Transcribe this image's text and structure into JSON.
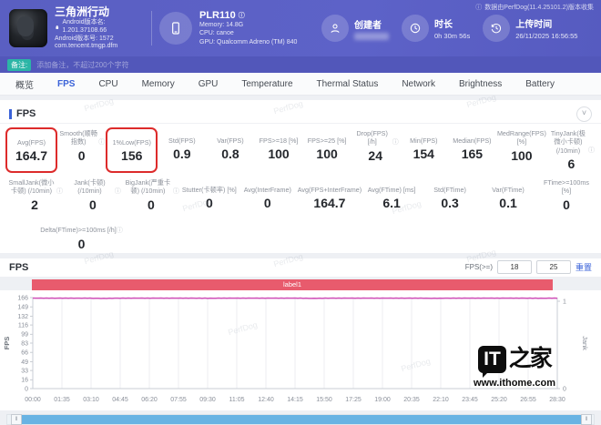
{
  "icons": {
    "info": "ⓘ",
    "chevron_down": "˅"
  },
  "header": {
    "app": {
      "title": "三角洲行动",
      "version_name": "Android版本名: 1.201.37108.66",
      "version_code": "Android版本号: 1572",
      "package": "com.tencent.tmgp.dfm"
    },
    "device": {
      "name": "PLR110",
      "memory": "Memory: 14.8G",
      "cpu": "CPU: canoe",
      "gpu": "GPU: Qualcomm Adreno (TM) 840"
    },
    "creator": {
      "label": "创建者",
      "value": ""
    },
    "duration": {
      "label": "时长",
      "value": "0h 30m 56s"
    },
    "upload": {
      "label": "上传时间",
      "value": "26/11/2025 16:56:55"
    },
    "collector_note": "数据由PerfDog(11.4.25101.2)版本收集"
  },
  "note_bar": {
    "badge": "备注:",
    "text": "添加备注，不超过200个字符"
  },
  "tabs": {
    "items": [
      "概览",
      "FPS",
      "CPU",
      "Memory",
      "GPU",
      "Temperature",
      "Thermal Status",
      "Network",
      "Brightness",
      "Battery"
    ],
    "active": "FPS"
  },
  "fps_card": {
    "title": "FPS",
    "stat_rows": [
      [
        {
          "label": "Avg(FPS)",
          "value": "164.7",
          "highlight": true
        },
        {
          "label": "Smooth(顺畅指数)",
          "info": true,
          "value": "0"
        },
        {
          "label": "1%Low(FPS)",
          "value": "156",
          "highlight": true
        },
        {
          "label": "Std(FPS)",
          "value": "0.9"
        },
        {
          "label": "Var(FPS)",
          "value": "0.8"
        },
        {
          "label": "FPS>=18 [%]",
          "value": "100"
        },
        {
          "label": "FPS>=25 [%]",
          "value": "100"
        },
        {
          "label": "Drop(FPS) [/h]",
          "info": true,
          "value": "24"
        },
        {
          "label": "Min(FPS)",
          "value": "154"
        },
        {
          "label": "Median(FPS)",
          "value": "165"
        },
        {
          "label": "MedRange(FPS)[%]",
          "value": "100"
        },
        {
          "label": "TinyJank(极微小卡顿) (/10min)",
          "info": true,
          "value": "6"
        }
      ],
      [
        {
          "label": "SmallJank(微小卡顿) (/10min)",
          "info": true,
          "value": "2"
        },
        {
          "label": "Jank(卡顿) (/10min)",
          "info": true,
          "value": "0"
        },
        {
          "label": "BigJank(严重卡顿) (/10min)",
          "info": true,
          "value": "0"
        },
        {
          "label": "Stutter(卡顿率) [%]",
          "value": "0"
        },
        {
          "label": "Avg(InterFrame)",
          "value": "0"
        },
        {
          "label": "Avg(FPS+InterFrame)",
          "value": "164.7"
        },
        {
          "label": "Avg(FTime) [ms]",
          "value": "6.1"
        },
        {
          "label": "Std(FTime)",
          "value": "0.3"
        },
        {
          "label": "Var(FTime)",
          "value": "0.1"
        },
        {
          "label": "FTime>=100ms [%]",
          "value": "0"
        }
      ],
      [
        {
          "label": "Delta(FTime)>=100ms [/h]",
          "info": true,
          "value": "0"
        }
      ]
    ]
  },
  "chart": {
    "title": "FPS",
    "threshold_label": "FPS(>=)",
    "threshold_values": [
      "18",
      "25"
    ],
    "reset_label": "重置",
    "banner_label": "label1"
  },
  "chart_data": {
    "type": "line",
    "title": "FPS",
    "ylabel_left": "FPS",
    "ylabel_right": "Jank",
    "ylim_left": [
      0,
      166
    ],
    "ylim_right": [
      0,
      1
    ],
    "y_ticks_left": [
      166,
      149,
      132,
      116,
      99,
      83,
      66,
      49,
      33,
      16,
      0
    ],
    "y_ticks_right": [
      1,
      0
    ],
    "x_ticks": [
      "00:00",
      "01:35",
      "03:10",
      "04:45",
      "06:20",
      "07:55",
      "09:30",
      "11:05",
      "12:40",
      "14:15",
      "15:50",
      "17:25",
      "19:00",
      "20:35",
      "22:10",
      "23:45",
      "25:20",
      "26:55",
      "28:30"
    ],
    "grid": "vertical",
    "legend_banner": "label1",
    "series": [
      {
        "name": "FPS",
        "color": "#cf4fb8",
        "x_minutes": [
          0,
          1,
          2,
          3,
          4,
          5,
          6,
          7,
          8,
          9,
          10,
          11,
          12,
          13,
          14,
          15,
          16,
          17,
          18,
          19,
          20,
          21,
          22,
          23,
          24,
          25,
          26,
          27,
          28,
          29,
          30
        ],
        "values": [
          165,
          165,
          165,
          165,
          164.5,
          165,
          165,
          165,
          165,
          165,
          164.8,
          165,
          165,
          165,
          165,
          165,
          164.6,
          165,
          165,
          165,
          165,
          165,
          165,
          164.7,
          165,
          165,
          165,
          165,
          165,
          164.8,
          165
        ]
      },
      {
        "name": "Jank",
        "color": "#7a8aa0",
        "x_minutes": [
          0,
          5,
          10,
          15,
          20,
          25,
          30
        ],
        "values": [
          0,
          0,
          0,
          0,
          0,
          0,
          0
        ]
      }
    ]
  },
  "watermarks": {
    "perfdog": "PerfDog",
    "it_logo": "IT",
    "it_cn": "之家",
    "site_url": "www.ithome.com"
  }
}
